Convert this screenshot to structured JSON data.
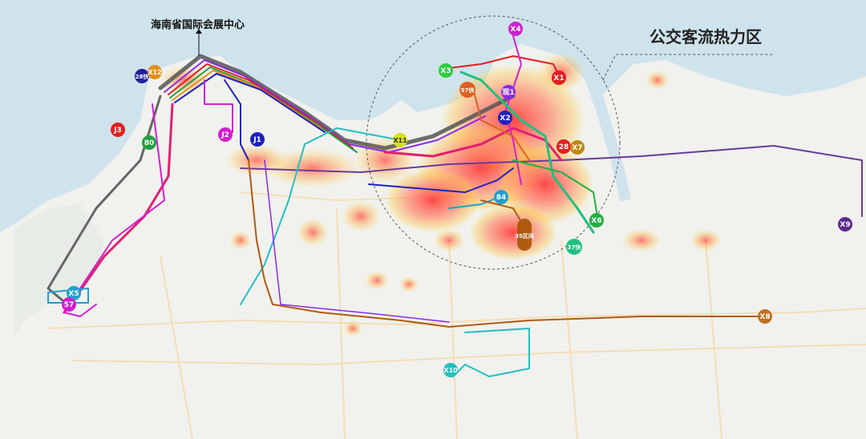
{
  "map": {
    "title": "公交客流热力区",
    "landmark": "海南省国际会展中心",
    "colors": {
      "sea": "#cfe4ee",
      "land": "#f2f2f0",
      "heat_core": "#ff3b3b",
      "heat_mid": "#ff9b6b",
      "heat_edge": "#ffd24a"
    },
    "route_labels": [
      {
        "id": "X4",
        "text": "X4",
        "color": "#d020d0"
      },
      {
        "id": "X3",
        "text": "X3",
        "color": "#2ecc40"
      },
      {
        "id": "X1",
        "text": "X1",
        "color": "#e02020"
      },
      {
        "id": "S7k",
        "text": "57快",
        "color": "#e06020"
      },
      {
        "id": "G1",
        "text": "观1",
        "color": "#8a2be2"
      },
      {
        "id": "X2",
        "text": "X2",
        "color": "#2020c0"
      },
      {
        "id": "N28",
        "text": "28",
        "color": "#e02020"
      },
      {
        "id": "X7",
        "text": "X7",
        "color": "#c08a10"
      },
      {
        "id": "X11",
        "text": "X11",
        "color": "#d8e020"
      },
      {
        "id": "N84",
        "text": "84",
        "color": "#20a0d0"
      },
      {
        "id": "Q35",
        "text": "35区间",
        "color": "#b05a10"
      },
      {
        "id": "X6",
        "text": "X6",
        "color": "#20b040"
      },
      {
        "id": "B37",
        "text": "37快",
        "color": "#20c080"
      },
      {
        "id": "X9",
        "text": "X9",
        "color": "#5a2a8a"
      },
      {
        "id": "X8",
        "text": "X8",
        "color": "#c07020"
      },
      {
        "id": "X10",
        "text": "X10",
        "color": "#20c0c0"
      },
      {
        "id": "K28",
        "text": "28快",
        "color": "#2020a0"
      },
      {
        "id": "X12",
        "text": "X12",
        "color": "#e09020"
      },
      {
        "id": "J3",
        "text": "J3",
        "color": "#e02020"
      },
      {
        "id": "N80",
        "text": "80",
        "color": "#20a040"
      },
      {
        "id": "J2",
        "text": "J2",
        "color": "#d020d0"
      },
      {
        "id": "J1",
        "text": "J1",
        "color": "#2020c0"
      },
      {
        "id": "X5",
        "text": "X5",
        "color": "#20a0d0"
      },
      {
        "id": "N57",
        "text": "57",
        "color": "#d020d0"
      }
    ]
  }
}
